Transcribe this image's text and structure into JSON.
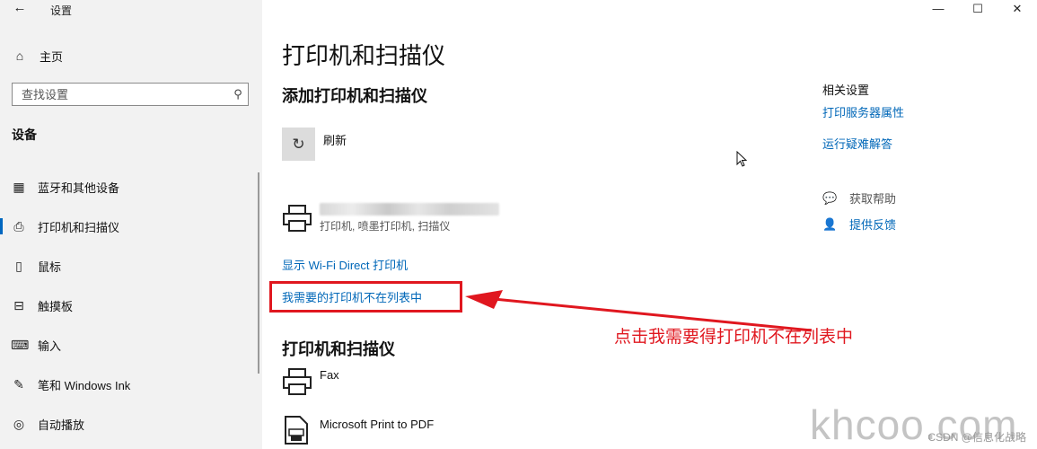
{
  "window": {
    "app_title": "设置",
    "back_icon": "←",
    "controls": {
      "minimize": "—",
      "maximize": "☐",
      "close": "✕"
    }
  },
  "sidebar": {
    "home_label": "主页",
    "search_placeholder": "查找设置",
    "section_heading": "设备",
    "items": [
      {
        "label": "蓝牙和其他设备",
        "icon": "bluetooth-devices-icon",
        "active": false
      },
      {
        "label": "打印机和扫描仪",
        "icon": "printer-icon",
        "active": true
      },
      {
        "label": "鼠标",
        "icon": "mouse-icon",
        "active": false
      },
      {
        "label": "触摸板",
        "icon": "touchpad-icon",
        "active": false
      },
      {
        "label": "输入",
        "icon": "keyboard-icon",
        "active": false
      },
      {
        "label": "笔和 Windows Ink",
        "icon": "pen-icon",
        "active": false
      },
      {
        "label": "自动播放",
        "icon": "autoplay-icon",
        "active": false
      }
    ]
  },
  "main": {
    "page_title": "打印机和扫描仪",
    "add_section_title": "添加打印机和扫描仪",
    "refresh_label": "刷新",
    "device1_desc": "打印机, 喷墨打印机, 扫描仪",
    "wifi_direct_link": "显示 Wi-Fi Direct 打印机",
    "missing_printer_link": "我需要的打印机不在列表中",
    "list_section_title": "打印机和扫描仪",
    "printers": [
      {
        "name": "Fax"
      },
      {
        "name": "Microsoft Print to PDF"
      }
    ]
  },
  "related": {
    "title": "相关设置",
    "print_server_link": "打印服务器属性",
    "troubleshoot_link": "运行疑难解答",
    "get_help": "获取帮助",
    "feedback": "提供反馈"
  },
  "annotation": {
    "text": "点击我需要得打印机不在列表中",
    "color": "#e0171f"
  },
  "watermarks": {
    "site": "khcoo.com",
    "csdn": "CSDN @信息化战略"
  },
  "colors": {
    "link": "#0067b8",
    "accent": "#0067c0",
    "sidebar_bg": "#f2f2f2",
    "annotation_red": "#e0171f"
  }
}
